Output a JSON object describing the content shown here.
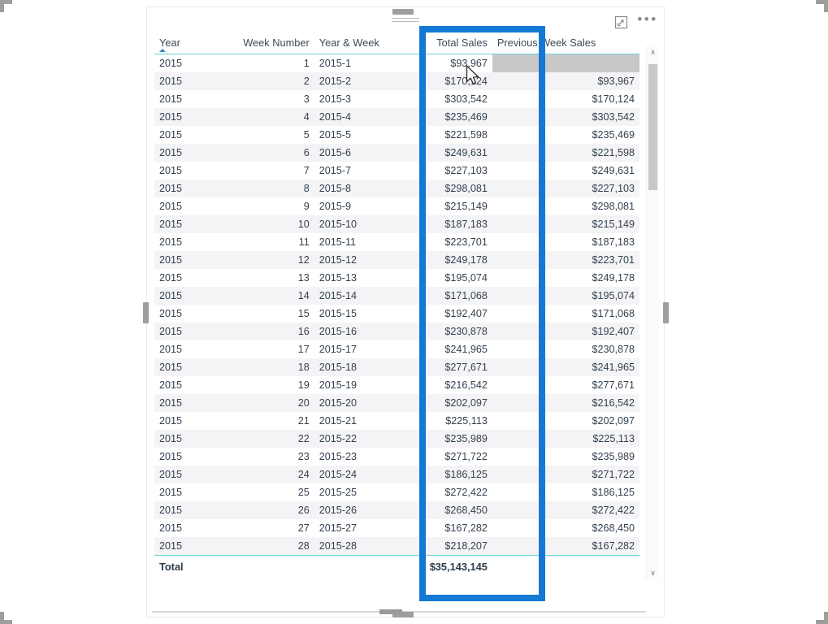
{
  "visual": {
    "type": "table",
    "drag_handle_name": "drag-handle",
    "header_icons": [
      {
        "name": "focus-mode-icon",
        "label": "Focus mode"
      },
      {
        "name": "more-options-icon",
        "label": "•••"
      }
    ]
  },
  "table": {
    "columns": [
      {
        "key": "year",
        "label": "Year",
        "align": "left",
        "sorted": "asc"
      },
      {
        "key": "week",
        "label": "Week Number",
        "align": "right",
        "sorted": ""
      },
      {
        "key": "yw",
        "label": "Year & Week",
        "align": "left",
        "sorted": ""
      },
      {
        "key": "ts",
        "label": "Total Sales",
        "align": "right",
        "sorted": ""
      },
      {
        "key": "pws",
        "label": "Previous Week Sales",
        "align": "right",
        "sorted": ""
      }
    ],
    "rows": [
      {
        "year": "2015",
        "week": "1",
        "yw": "2015-1",
        "ts": "$93,967",
        "pws": ""
      },
      {
        "year": "2015",
        "week": "2",
        "yw": "2015-2",
        "ts": "$170,124",
        "pws": "$93,967"
      },
      {
        "year": "2015",
        "week": "3",
        "yw": "2015-3",
        "ts": "$303,542",
        "pws": "$170,124"
      },
      {
        "year": "2015",
        "week": "4",
        "yw": "2015-4",
        "ts": "$235,469",
        "pws": "$303,542"
      },
      {
        "year": "2015",
        "week": "5",
        "yw": "2015-5",
        "ts": "$221,598",
        "pws": "$235,469"
      },
      {
        "year": "2015",
        "week": "6",
        "yw": "2015-6",
        "ts": "$249,631",
        "pws": "$221,598"
      },
      {
        "year": "2015",
        "week": "7",
        "yw": "2015-7",
        "ts": "$227,103",
        "pws": "$249,631"
      },
      {
        "year": "2015",
        "week": "8",
        "yw": "2015-8",
        "ts": "$298,081",
        "pws": "$227,103"
      },
      {
        "year": "2015",
        "week": "9",
        "yw": "2015-9",
        "ts": "$215,149",
        "pws": "$298,081"
      },
      {
        "year": "2015",
        "week": "10",
        "yw": "2015-10",
        "ts": "$187,183",
        "pws": "$215,149"
      },
      {
        "year": "2015",
        "week": "11",
        "yw": "2015-11",
        "ts": "$223,701",
        "pws": "$187,183"
      },
      {
        "year": "2015",
        "week": "12",
        "yw": "2015-12",
        "ts": "$249,178",
        "pws": "$223,701"
      },
      {
        "year": "2015",
        "week": "13",
        "yw": "2015-13",
        "ts": "$195,074",
        "pws": "$249,178"
      },
      {
        "year": "2015",
        "week": "14",
        "yw": "2015-14",
        "ts": "$171,068",
        "pws": "$195,074"
      },
      {
        "year": "2015",
        "week": "15",
        "yw": "2015-15",
        "ts": "$192,407",
        "pws": "$171,068"
      },
      {
        "year": "2015",
        "week": "16",
        "yw": "2015-16",
        "ts": "$230,878",
        "pws": "$192,407"
      },
      {
        "year": "2015",
        "week": "17",
        "yw": "2015-17",
        "ts": "$241,965",
        "pws": "$230,878"
      },
      {
        "year": "2015",
        "week": "18",
        "yw": "2015-18",
        "ts": "$277,671",
        "pws": "$241,965"
      },
      {
        "year": "2015",
        "week": "19",
        "yw": "2015-19",
        "ts": "$216,542",
        "pws": "$277,671"
      },
      {
        "year": "2015",
        "week": "20",
        "yw": "2015-20",
        "ts": "$202,097",
        "pws": "$216,542"
      },
      {
        "year": "2015",
        "week": "21",
        "yw": "2015-21",
        "ts": "$225,113",
        "pws": "$202,097"
      },
      {
        "year": "2015",
        "week": "22",
        "yw": "2015-22",
        "ts": "$235,989",
        "pws": "$225,113"
      },
      {
        "year": "2015",
        "week": "23",
        "yw": "2015-23",
        "ts": "$271,722",
        "pws": "$235,989"
      },
      {
        "year": "2015",
        "week": "24",
        "yw": "2015-24",
        "ts": "$186,125",
        "pws": "$271,722"
      },
      {
        "year": "2015",
        "week": "25",
        "yw": "2015-25",
        "ts": "$272,422",
        "pws": "$186,125"
      },
      {
        "year": "2015",
        "week": "26",
        "yw": "2015-26",
        "ts": "$268,450",
        "pws": "$272,422"
      },
      {
        "year": "2015",
        "week": "27",
        "yw": "2015-27",
        "ts": "$167,282",
        "pws": "$268,450"
      },
      {
        "year": "2015",
        "week": "28",
        "yw": "2015-28",
        "ts": "$218,207",
        "pws": "$167,282"
      }
    ],
    "total": {
      "label": "Total",
      "year": "Total",
      "week": "",
      "yw": "",
      "ts": "$35,143,145",
      "pws": ""
    }
  },
  "annotation": {
    "name": "previous-week-sales-highlight",
    "color": "#1379d4",
    "target_column": "Previous Week Sales"
  },
  "scrollbars": {
    "vertical": {
      "up_glyph": "∧",
      "down_glyph": "∨"
    },
    "horizontal": {}
  },
  "colors": {
    "accent_blue": "#1379d4",
    "header_rule": "#69d3dd",
    "text": "#33414f",
    "row_alt": "#f4f4f6",
    "hover": "#c8c8c8"
  }
}
